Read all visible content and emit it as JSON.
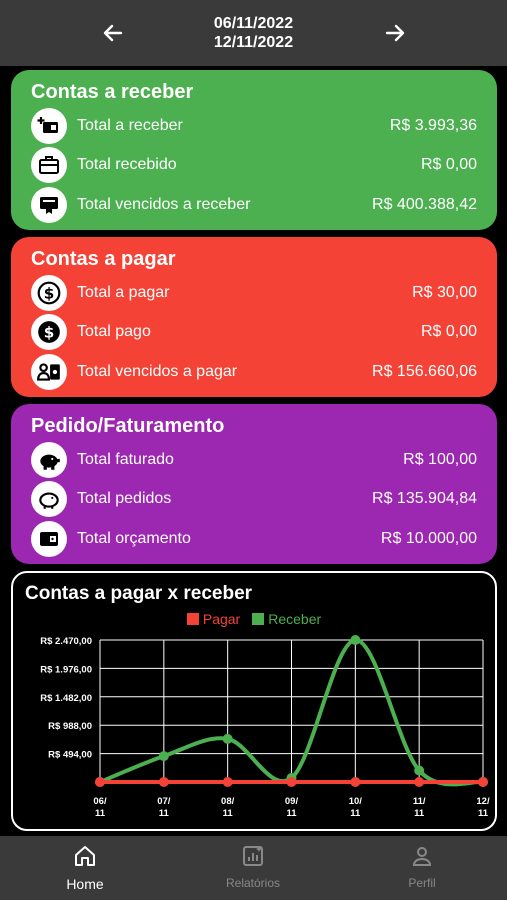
{
  "header": {
    "date_start": "06/11/2022",
    "date_end": "12/11/2022"
  },
  "receber": {
    "title": "Contas a receber",
    "color": "#4caf50",
    "items": [
      {
        "label": "Total a receber",
        "value": "R$ 3.993,36",
        "icon": "wallet-add-icon"
      },
      {
        "label": "Total recebido",
        "value": "R$ 0,00",
        "icon": "briefcase-icon"
      },
      {
        "label": "Total vencidos a receber",
        "value": "R$ 400.388,42",
        "icon": "certificate-icon"
      }
    ]
  },
  "pagar": {
    "title": "Contas a pagar",
    "color": "#f44336",
    "items": [
      {
        "label": "Total a pagar",
        "value": "R$ 30,00",
        "icon": "dollar-coin-icon"
      },
      {
        "label": "Total pago",
        "value": "R$ 0,00",
        "icon": "dollar-filled-icon"
      },
      {
        "label": "Total vencidos a pagar",
        "value": "R$ 156.660,06",
        "icon": "person-cash-icon"
      }
    ]
  },
  "pedido": {
    "title": "Pedido/Faturamento",
    "color": "#9c27b0",
    "items": [
      {
        "label": "Total faturado",
        "value": "R$ 100,00",
        "icon": "piggy-bank-icon"
      },
      {
        "label": "Total pedidos",
        "value": "R$ 135.904,84",
        "icon": "piggy-outline-icon"
      },
      {
        "label": "Total orçamento",
        "value": "R$ 10.000,00",
        "icon": "wallet-icon"
      }
    ]
  },
  "chart_data": {
    "type": "line",
    "title": "Contas a pagar x receber",
    "categories": [
      "06/\n11",
      "07/\n11",
      "08/\n11",
      "09/\n11",
      "10/\n11",
      "11/\n11",
      "12/\n11"
    ],
    "y_ticks": [
      "R$ 2.470,00",
      "R$ 1.976,00",
      "R$ 1.482,00",
      "R$ 988,00",
      "R$ 494,00"
    ],
    "ylim": [
      0,
      2470
    ],
    "series": [
      {
        "name": "Pagar",
        "color": "#f44336",
        "values": [
          0,
          0,
          0,
          0,
          0,
          0,
          0
        ]
      },
      {
        "name": "Receber",
        "color": "#4caf50",
        "values": [
          0,
          450,
          750,
          70,
          2470,
          200,
          0
        ]
      }
    ]
  },
  "tabs": [
    {
      "label": "Home",
      "icon": "home-icon"
    },
    {
      "label": "Relatórios",
      "icon": "reports-icon"
    },
    {
      "label": "Perfil",
      "icon": "profile-icon"
    }
  ]
}
